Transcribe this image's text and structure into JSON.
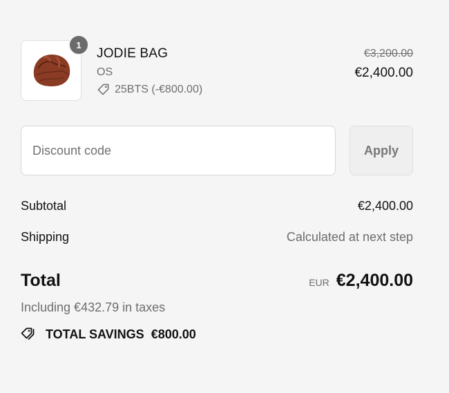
{
  "line_item": {
    "quantity": "1",
    "name": "JODIE BAG",
    "variant": "OS",
    "discount": "25BTS (-€800.00)",
    "original_price": "€3,200.00",
    "price": "€2,400.00",
    "image_icon": "handbag-image",
    "product_color": "#8a3b24"
  },
  "discount_form": {
    "placeholder": "Discount code",
    "apply_label": "Apply"
  },
  "summary": {
    "subtotal_label": "Subtotal",
    "subtotal_value": "€2,400.00",
    "shipping_label": "Shipping",
    "shipping_value": "Calculated at next step",
    "total_label": "Total",
    "currency": "EUR",
    "total_value": "€2,400.00",
    "taxes": "Including €432.79 in taxes",
    "savings_label": "TOTAL SAVINGS",
    "savings_value": "€800.00",
    "savings_icon": "tags-icon"
  }
}
